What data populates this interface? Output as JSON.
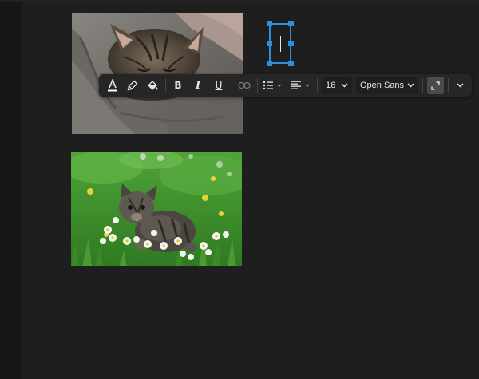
{
  "canvas": {
    "images": [
      {
        "subject": "tabby-kitten-sleeping-on-grey-blanket"
      },
      {
        "subject": "kitten-in-grass-with-daisies"
      }
    ]
  },
  "text_box": {
    "content": ""
  },
  "toolbar": {
    "text_color_icon": "font-color-icon",
    "highlight_icon": "highlighter-icon",
    "fill_icon": "paint-bucket-icon",
    "bold_label": "B",
    "italic_label": "I",
    "underline_label": "U",
    "link_icon": "link-icon",
    "list_icon": "bulleted-list-icon",
    "align_icon": "align-left-icon",
    "font_size": "16",
    "font_family": "Open Sans",
    "resize_icon": "expand-icon",
    "more_icon": "chevron-down-icon",
    "colors": {
      "text_color_underline": "#ffffff",
      "selection": "#2d8fd6"
    }
  }
}
